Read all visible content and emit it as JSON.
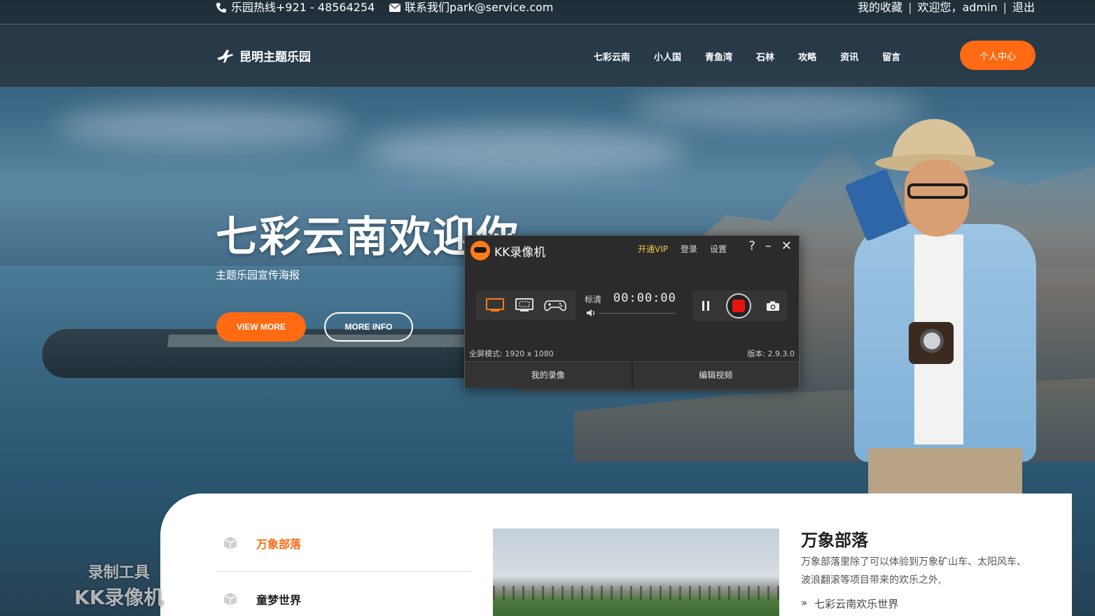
{
  "topbar": {
    "hotline": "乐园热线+921 - 48564254",
    "contact": "联系我们park@service.com",
    "favorites": "我的收藏",
    "welcome": "欢迎您，admin",
    "logout": "退出",
    "separator": "|"
  },
  "header": {
    "brand": "昆明主题乐园",
    "nav": [
      "七彩云南",
      "小人国",
      "青鱼湾",
      "石林",
      "攻略",
      "资讯",
      "留言"
    ],
    "user_center": "个人中心"
  },
  "hero": {
    "title": "七彩云南欢迎你",
    "subtitle": "主题乐园宣传海报",
    "btn_view": "VIEW MORE",
    "btn_more": "MORE INFO"
  },
  "section": {
    "tabs": [
      "万象部落",
      "童梦世界"
    ],
    "info_title": "万象部落",
    "info_desc": "万象部落里除了可以体验到万象矿山车、太阳风车、波浪翻滚等项目带来的欢乐之外,",
    "info_link": "七彩云南欢乐世界",
    "info_link_prefix": "»"
  },
  "recorder": {
    "title": "KK录像机",
    "vip": "开通VIP",
    "login": "登录",
    "settings": "设置",
    "help": "?",
    "minimize": "–",
    "close": "✕",
    "quality": "标清",
    "timer": "00:00:00",
    "mode_status": "全屏模式: 1920 x 1080",
    "version": "版本: 2.9.3.0",
    "tab_my": "我的录像",
    "tab_edit": "编辑视频"
  },
  "watermark": {
    "line1": "录制工具",
    "line2": "KK录像机"
  },
  "colors": {
    "accent": "#ff6a13",
    "record": "#e8140f",
    "vip": "#f2c94c"
  }
}
